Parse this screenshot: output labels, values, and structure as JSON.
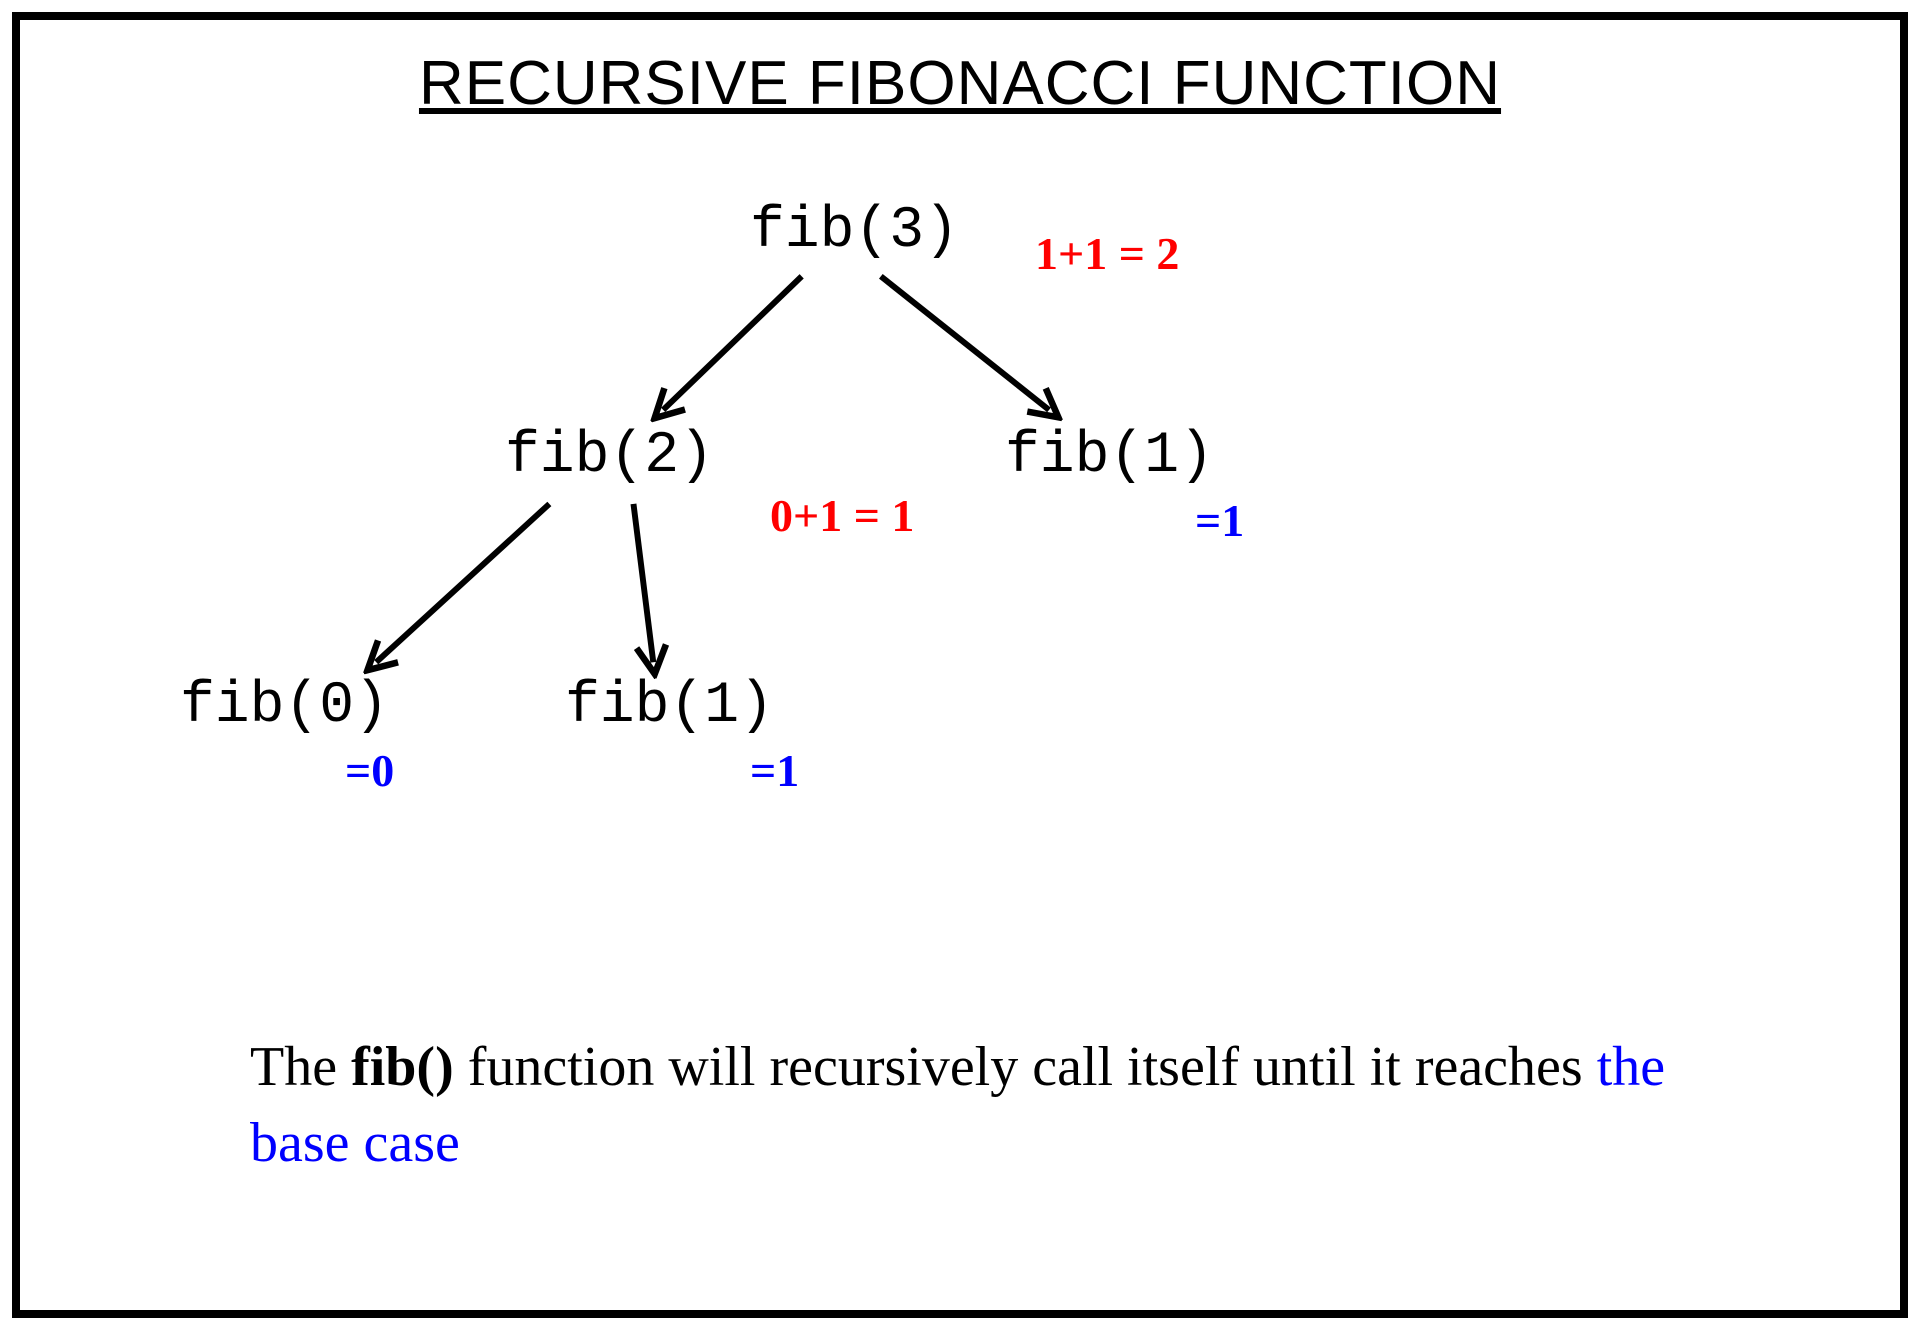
{
  "title": "RECURSIVE FIBONACCI FUNCTION",
  "nodes": {
    "fib3": "fib(3)",
    "fib2": "fib(2)",
    "fib1a": "fib(1)",
    "fib0": "fib(0)",
    "fib1b": "fib(1)"
  },
  "results_red": {
    "r1": "1+1 = 2",
    "r2": "0+1 = 1"
  },
  "results_blue": {
    "b1": "=1",
    "b2": "=0",
    "b3": "=1"
  },
  "caption": {
    "part1": "The ",
    "bold": "fib()",
    "part2": " function will recursively call itself until it reaches ",
    "blue": "the base case"
  }
}
